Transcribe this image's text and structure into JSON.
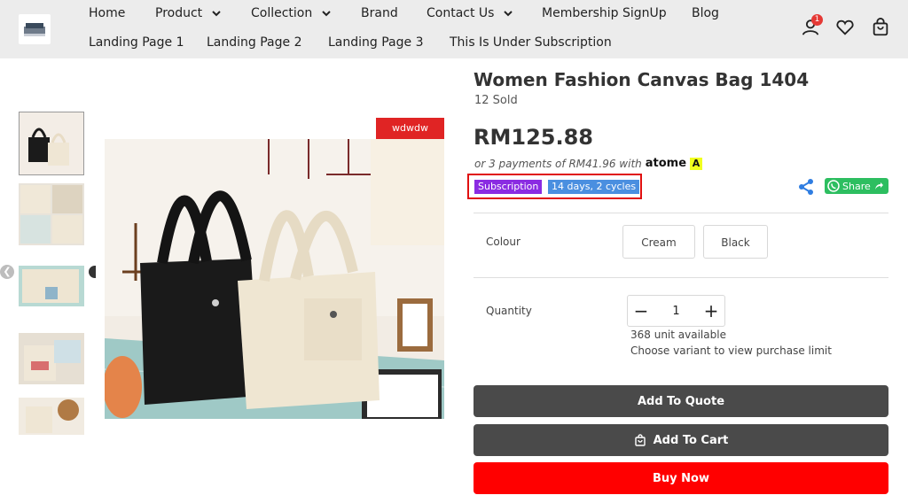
{
  "header": {
    "nav_row1": [
      {
        "label": "Home",
        "dropdown": false
      },
      {
        "label": "Product",
        "dropdown": true
      },
      {
        "label": "Collection",
        "dropdown": true
      },
      {
        "label": "Brand",
        "dropdown": false
      },
      {
        "label": "Contact Us",
        "dropdown": true
      },
      {
        "label": "Membership SignUp",
        "dropdown": false
      },
      {
        "label": "Blog",
        "dropdown": false
      }
    ],
    "nav_row2": [
      {
        "label": "Landing Page 1"
      },
      {
        "label": "Landing Page 2"
      },
      {
        "label": "Landing Page 3"
      },
      {
        "label": "This Is Under Subscription"
      }
    ],
    "account_badge": "1",
    "icons": [
      "user-icon",
      "heart-icon",
      "shopping-bag-icon"
    ]
  },
  "gallery": {
    "promo_tag": "wdwdw",
    "thumbnail_count": 5
  },
  "product": {
    "title": "Women Fashion Canvas Bag 1404",
    "sold": "12 Sold",
    "price": "RM125.88",
    "installment_text": "or 3 payments of RM41.96 with",
    "installment_provider": "atome",
    "subscription_label": "Subscription",
    "cycle_label": "14 days, 2 cycles",
    "share_label": "Share",
    "colour_label": "Colour",
    "colour_options": [
      "Cream",
      "Black"
    ],
    "quantity_label": "Quantity",
    "quantity_value": "1",
    "stock_text": "368 unit available",
    "limit_text": "Choose variant to view purchase limit"
  },
  "actions": {
    "add_to_quote": "Add To Quote",
    "add_to_cart": "Add To Cart",
    "buy_now": "Buy Now"
  },
  "colors": {
    "subscription": "#8a2be2",
    "cycles": "#4a8fe0",
    "buy_now": "#ff0000",
    "dark_button": "#4a4a4a",
    "whatsapp": "#2dbe60",
    "promo_tag": "#e02424"
  }
}
